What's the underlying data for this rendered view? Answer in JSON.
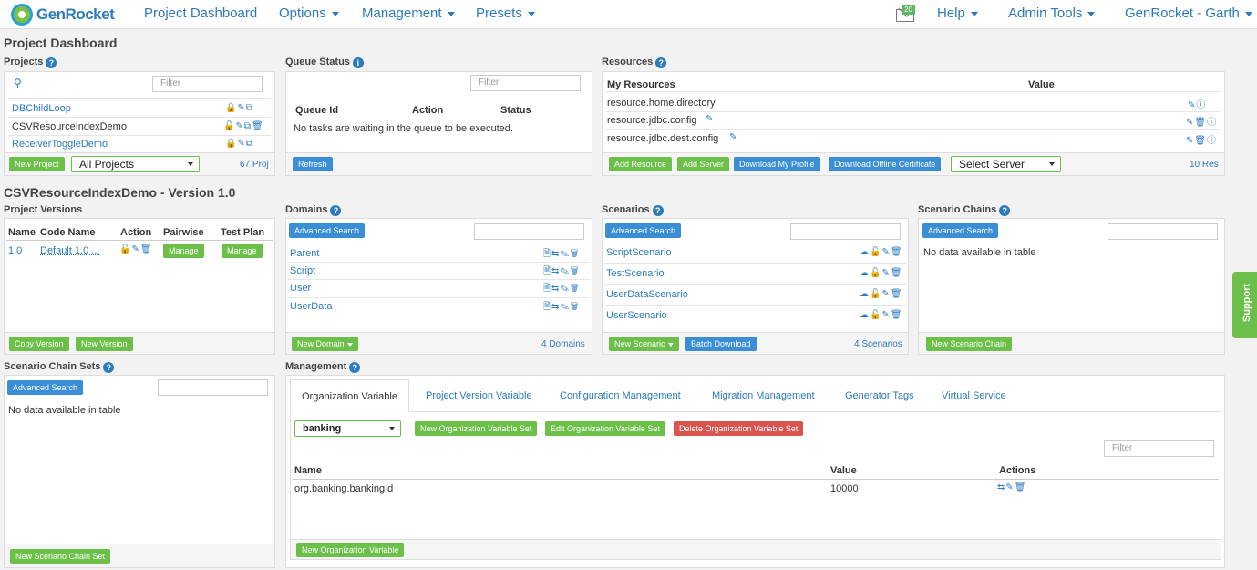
{
  "nav": {
    "brand": "GenRocket",
    "dashboard": "Project Dashboard",
    "options": "Options",
    "management": "Management",
    "presets": "Presets",
    "mail_count": "20",
    "help": "Help",
    "admin": "Admin Tools",
    "user": "GenRocket - Garth"
  },
  "page_title": "Project Dashboard",
  "projects": {
    "title": "Projects",
    "filter_ph": "Filter",
    "items": [
      "DBChildLoop",
      "CSVResourceIndexDemo",
      "ReceiverToggleDemo"
    ],
    "new_btn": "New Project",
    "select": "All Projects",
    "count": "67 Proj"
  },
  "queue": {
    "title": "Queue Status",
    "filter_ph": "Filter",
    "cols": [
      "Queue Id",
      "Action",
      "Status"
    ],
    "empty": "No tasks are waiting in the queue to be executed.",
    "refresh": "Refresh"
  },
  "resources": {
    "title": "Resources",
    "cols": [
      "My Resources",
      "Value"
    ],
    "rows": [
      "resource.home.directory",
      "resource.jdbc.config",
      "resource.jdbc.dest.config"
    ],
    "add_resource": "Add Resource",
    "add_server": "Add Server",
    "download_profile": "Download My Profile",
    "download_cert": "Download Offline Certificate",
    "select_server": "Select Server",
    "count": "10 Res"
  },
  "version_title": "CSVResourceIndexDemo - Version 1.0",
  "versions": {
    "title": "Project Versions",
    "cols": [
      "Name",
      "Code Name",
      "Action",
      "Pairwise",
      "Test Plan"
    ],
    "row": {
      "name": "1.0",
      "code": "Default 1.0 ...",
      "manage1": "Manage",
      "manage2": "Manage"
    },
    "copy": "Copy Version",
    "new": "New Version"
  },
  "domains": {
    "title": "Domains",
    "adv": "Advanced Search",
    "items": [
      "Parent",
      "Script",
      "User",
      "UserData"
    ],
    "new": "New Domain",
    "count": "4 Domains"
  },
  "scenarios": {
    "title": "Scenarios",
    "adv": "Advanced Search",
    "items": [
      "ScriptScenario",
      "TestScenario",
      "UserDataScenario",
      "UserScenario"
    ],
    "new": "New Scenario",
    "batch": "Batch Download",
    "count": "4 Scenarios"
  },
  "chains": {
    "title": "Scenario Chains",
    "adv": "Advanced Search",
    "empty": "No data available in table",
    "new": "New Scenario Chain"
  },
  "chainsets": {
    "title": "Scenario Chain Sets",
    "adv": "Advanced Search",
    "empty": "No data available in table",
    "new": "New Scenario Chain Set"
  },
  "mgmt": {
    "title": "Management",
    "tabs": [
      "Organization Variable",
      "Project Version Variable",
      "Configuration Management",
      "Migration Management",
      "Generator Tags",
      "Virtual Service"
    ],
    "select": "banking",
    "new_set": "New Organization Variable Set",
    "edit_set": "Edit Organization Variable Set",
    "del_set": "Delete Organization Variable Set",
    "filter_ph": "Filter",
    "cols": [
      "Name",
      "Value",
      "Actions"
    ],
    "row": {
      "name": "org.banking.bankingId",
      "value": "10000"
    },
    "new_var": "New Organization Variable"
  },
  "support": "Support"
}
